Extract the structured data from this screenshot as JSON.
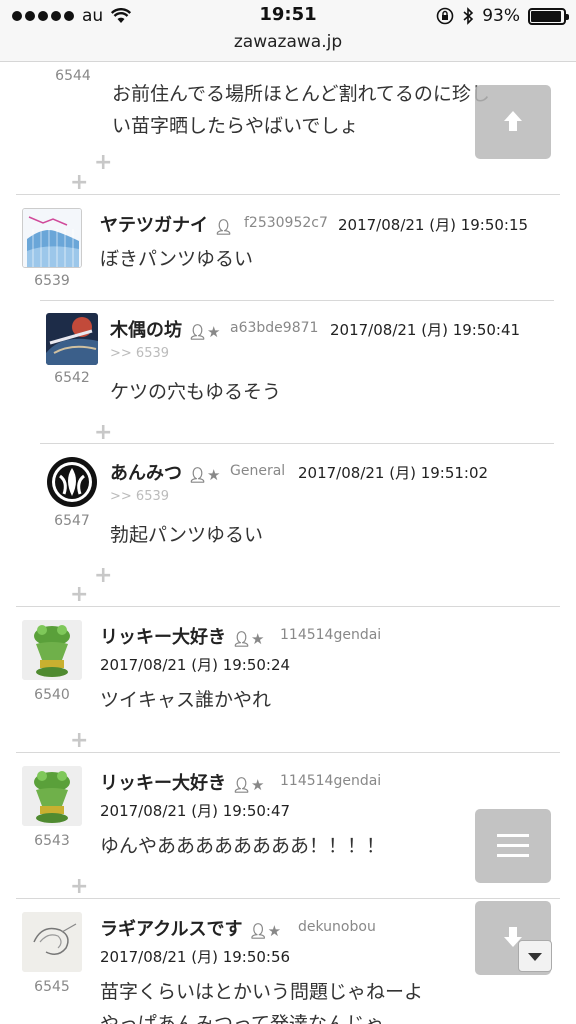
{
  "status_bar": {
    "carrier": "au",
    "time": "19:51",
    "battery": "93%",
    "battery_level": 0.93,
    "url": "zawazawa.jp"
  },
  "posts": [
    {
      "resno": "6544",
      "body": [
        "お前住んでる場所ほとんど割れてるのに珍し",
        "い苗字晒したらやばいでしょ"
      ]
    },
    {
      "resno": "6539",
      "name": "ヤテツガナイ",
      "uid": "f2530952c7",
      "date": "2017/08/21 (月) 19:50:15",
      "body": [
        "ぼきパンツゆるい"
      ]
    },
    {
      "resno": "6542",
      "name": "木偶の坊",
      "uid": "a63bde9871",
      "date": "2017/08/21 (月) 19:50:41",
      "anchor": ">> 6539",
      "body": [
        "ケツの穴もゆるそう"
      ]
    },
    {
      "resno": "6547",
      "name": "あんみつ",
      "uid": "General",
      "date": "2017/08/21 (月) 19:51:02",
      "anchor": ">> 6539",
      "body": [
        "勃起パンツゆるい"
      ]
    },
    {
      "resno": "6540",
      "name": "リッキー大好き",
      "uid": "114514gendai",
      "date": "2017/08/21 (月) 19:50:24",
      "body": [
        "ツイキャス誰かやれ"
      ]
    },
    {
      "resno": "6543",
      "name": "リッキー大好き",
      "uid": "114514gendai",
      "date": "2017/08/21 (月) 19:50:47",
      "body": [
        "ゆんやああああああああ！！！！"
      ]
    },
    {
      "resno": "6545",
      "name": "ラギアクルスです",
      "uid": "dekunobou",
      "date": "2017/08/21 (月) 19:50:56",
      "body": [
        "苗字くらいはとかいう問題じゃねーよ",
        "やっぱあんみつって発達なんじゃ"
      ]
    }
  ],
  "colors": {
    "divider": "#d8d8d8",
    "float_button": "#b9b9b9",
    "muted_text": "#888888"
  },
  "icons": {
    "scroll_top": "arrow-up-icon",
    "menu": "hamburger-icon",
    "scroll_bottom": "arrow-down-icon",
    "user": "user-icon",
    "user_star": "user-star-icon",
    "reply": "plus-icon"
  }
}
